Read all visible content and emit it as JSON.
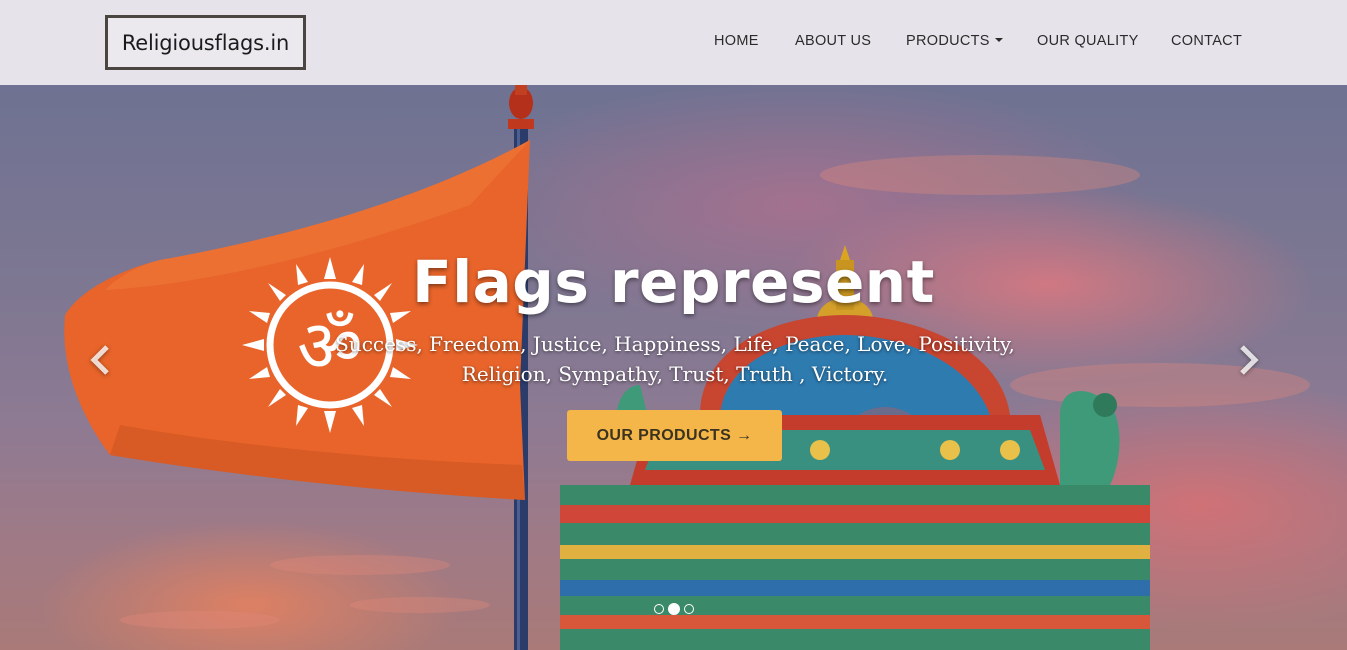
{
  "header": {
    "logo_text": "Religiousflags.in",
    "nav": [
      {
        "label": "HOME"
      },
      {
        "label": "ABOUT US"
      },
      {
        "label": "PRODUCTS"
      },
      {
        "label": "OUR QUALITY"
      },
      {
        "label": "CONTACT"
      }
    ]
  },
  "hero": {
    "title": "Flags represent",
    "subtitle": "Success, Freedom, Justice, Happiness, Life, Peace, Love, Positivity, Religion, Sympathy, Trust, Truth , Victory.",
    "cta_label": "OUR PRODUCTS →",
    "slides": {
      "count": 3,
      "active_index": 1
    },
    "flag_symbol": "om-symbol",
    "controls": {
      "prev_icon": "chevron-left-icon",
      "next_icon": "chevron-right-icon"
    }
  },
  "colors": {
    "header_bg": "#e6e4ea",
    "cta_bg": "#f5b649",
    "flag": "#e8642a"
  }
}
